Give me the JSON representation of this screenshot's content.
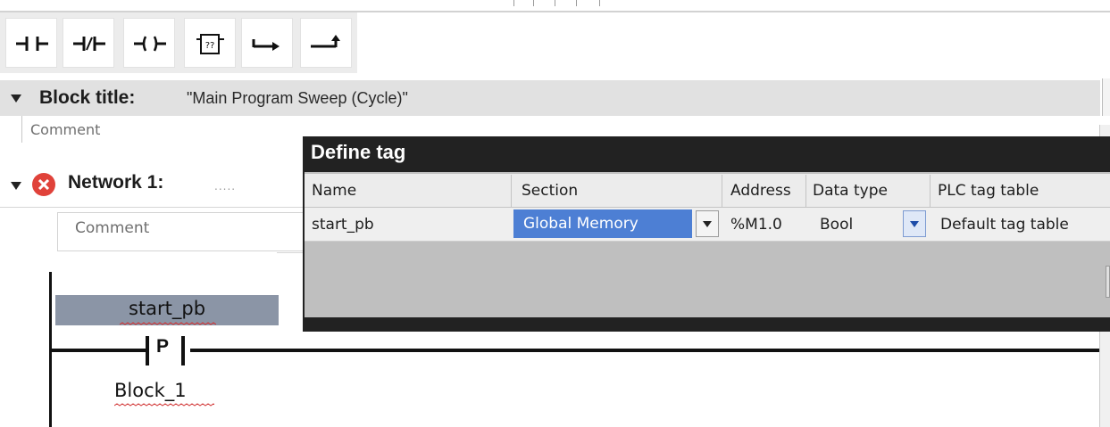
{
  "toolbar": {
    "items": [
      {
        "name": "normally-open-contact",
        "icon": "contact-no-icon"
      },
      {
        "name": "normally-closed-contact",
        "icon": "contact-nc-icon"
      },
      {
        "name": "output-coil",
        "icon": "coil-icon"
      },
      {
        "name": "empty-box",
        "icon": "empty-box-icon"
      },
      {
        "name": "open-branch",
        "icon": "open-branch-icon"
      },
      {
        "name": "close-branch",
        "icon": "close-branch-icon"
      }
    ],
    "empty_box_glyph": "??"
  },
  "block": {
    "title_label": "Block title:",
    "title_value": "\"Main Program Sweep (Cycle)\"",
    "comment": "Comment"
  },
  "network": {
    "label": "Network 1:",
    "dots": ".....",
    "comment": "Comment",
    "status": "error"
  },
  "ladder": {
    "contact_tag": "start_pb",
    "contact_type": "P",
    "operand_below": "Block_1"
  },
  "dialog": {
    "title": "Define tag",
    "columns": [
      "Name",
      "Section",
      "Address",
      "Data type",
      "PLC tag table"
    ],
    "row": {
      "name": "start_pb",
      "section": "Global Memory",
      "address": "%M1.0",
      "data_type": "Bool",
      "plc_tag_table": "Default tag table"
    }
  },
  "colors": {
    "toolbar_bg": "#ececec",
    "title_bar_bg": "#e1e1e1",
    "dialog_frame": "#222222",
    "selection": "#4d7fd4",
    "tag_highlight": "#8b95a6",
    "error": "#e0423a"
  }
}
